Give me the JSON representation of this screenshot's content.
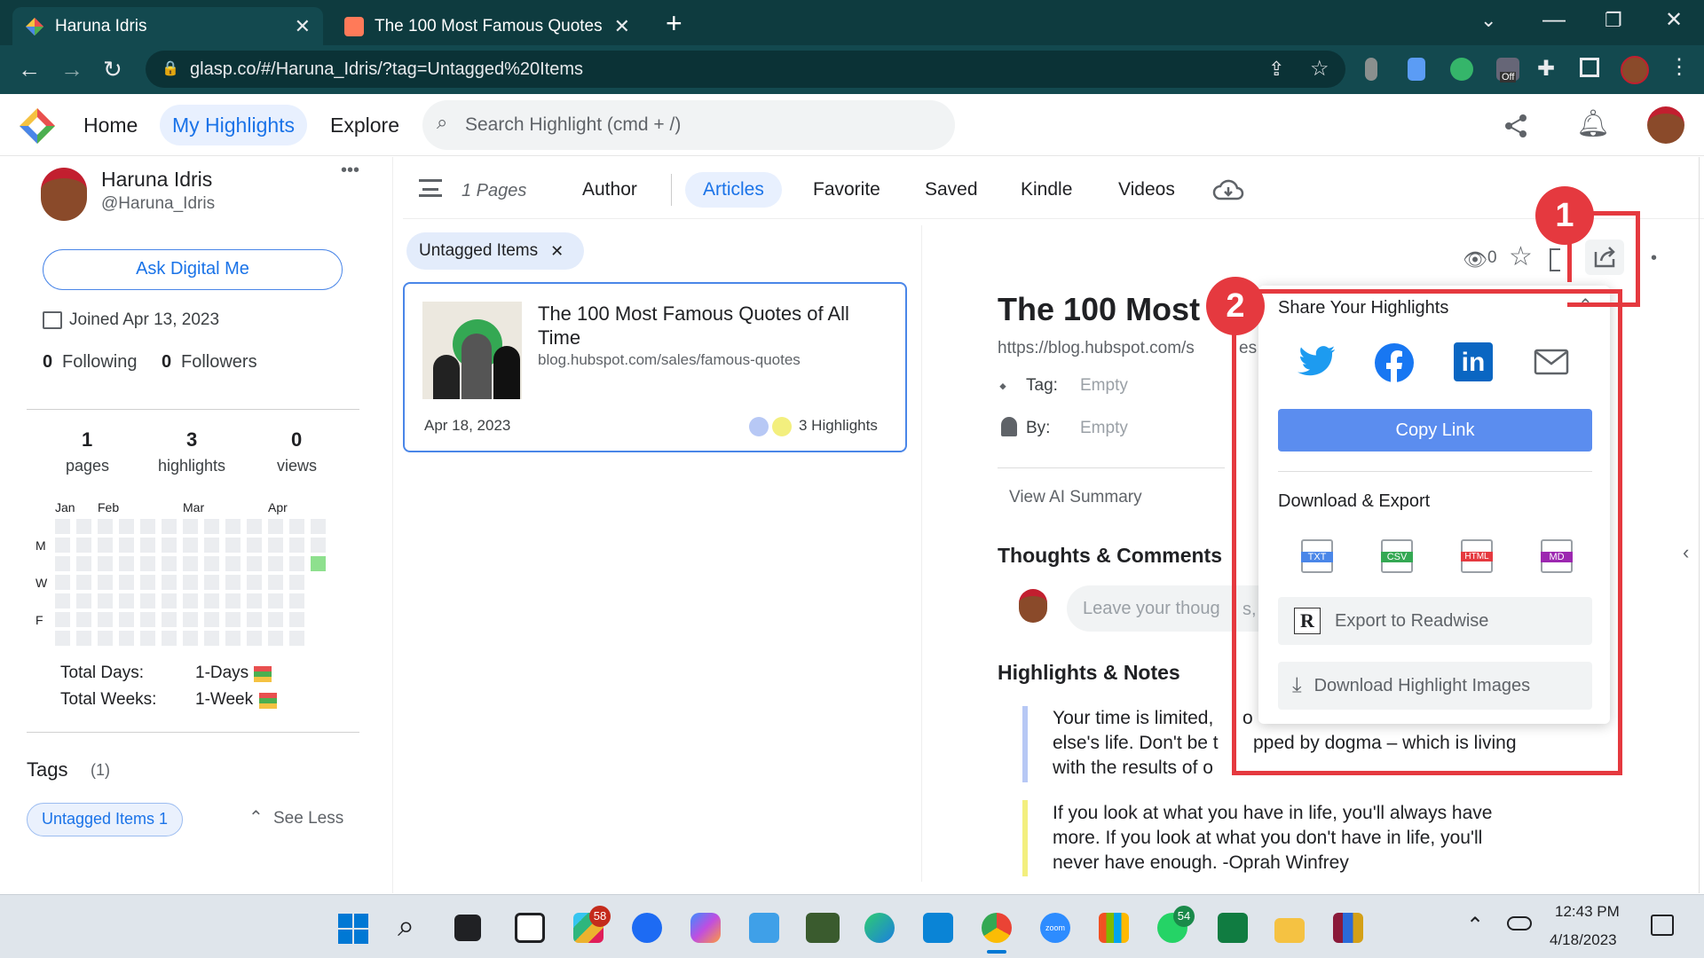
{
  "browser": {
    "tabs": [
      {
        "title": "Haruna Idris",
        "active": true
      },
      {
        "title": "The 100 Most Famous Quotes of",
        "active": false
      }
    ],
    "url": "glasp.co/#/Haruna_Idris/?tag=Untagged%20Items",
    "extension_off_label": "Off"
  },
  "app": {
    "nav": {
      "home": "Home",
      "my_highlights": "My Highlights",
      "explore": "Explore"
    },
    "search_placeholder": "Search Highlight (cmd + /)"
  },
  "profile": {
    "name": "Haruna Idris",
    "handle": "@Haruna_Idris",
    "more": "•••",
    "ask_button": "Ask Digital Me",
    "joined": "Joined Apr 13, 2023",
    "following_count": "0",
    "following_label": "Following",
    "followers_count": "0",
    "followers_label": "Followers",
    "stats": [
      {
        "value": "1",
        "label": "pages"
      },
      {
        "value": "3",
        "label": "highlights"
      },
      {
        "value": "0",
        "label": "views"
      }
    ],
    "months": [
      "Jan",
      "Feb",
      "Mar",
      "Apr"
    ],
    "weekdays": [
      "M",
      "W",
      "F"
    ],
    "total_days_label": "Total Days:",
    "total_days_value": "1-Days",
    "total_weeks_label": "Total Weeks:",
    "total_weeks_value": "1-Week",
    "tags_title": "Tags",
    "tags_count": "(1)",
    "tag_chip": "Untagged Items 1",
    "see_less": "See Less"
  },
  "filters": {
    "pages_count": "1 Pages",
    "tabs": [
      "Author",
      "Articles",
      "Favorite",
      "Saved",
      "Kindle",
      "Videos"
    ],
    "active_tab": "Articles",
    "active_tag": "Untagged Items"
  },
  "card": {
    "title": "The 100 Most Famous Quotes of All Time",
    "url": "blog.hubspot.com/sales/famous-quotes",
    "date": "Apr 18, 2023",
    "highlights": "3 Highlights"
  },
  "article": {
    "views": "0",
    "title": "The 100 Most",
    "url": "https://blog.hubspot.com/s",
    "url_tail": "es",
    "tag_label": "Tag:",
    "tag_value": "Empty",
    "by_label": "By:",
    "by_value": "Empty",
    "ai_summary": "View AI Summary",
    "thoughts_title": "Thoughts & Comments",
    "comment_placeholder": "Leave your thoug",
    "comment_tail": "s,",
    "highlights_title": "Highlights & Notes",
    "highlight1": [
      "Your time is limited,",
      "o",
      "else's life. Don't be t",
      "pped by dogma – which is living",
      "with the results of o"
    ],
    "highlight2": [
      "If you look at what you have in life, you'll always have",
      "more. If you look at what you don't have in life, you'll",
      "never have enough. -Oprah Winfrey"
    ]
  },
  "share_popup": {
    "title": "Share Your Highlights",
    "icons": [
      "twitter-icon",
      "facebook-icon",
      "linkedin-icon",
      "mail-icon"
    ],
    "copy_link": "Copy Link",
    "download_title": "Download & Export",
    "formats": [
      "TXT",
      "CSV",
      "HTML",
      "MD"
    ],
    "readwise": "Export to Readwise",
    "readwise_logo": "R",
    "download_images": "Download Highlight Images"
  },
  "annotations": {
    "step1": "1",
    "step2": "2"
  },
  "taskbar": {
    "slack_badge": "58",
    "whatsapp_badge": "54",
    "zoom_label": "zoom",
    "time": "12:43 PM",
    "date": "4/18/2023"
  },
  "colors": {
    "accent": "#1a73e8",
    "brand_dark": "#0e3b3f",
    "annotation_red": "#e5393f",
    "copy_link_bg": "#5b8def"
  }
}
